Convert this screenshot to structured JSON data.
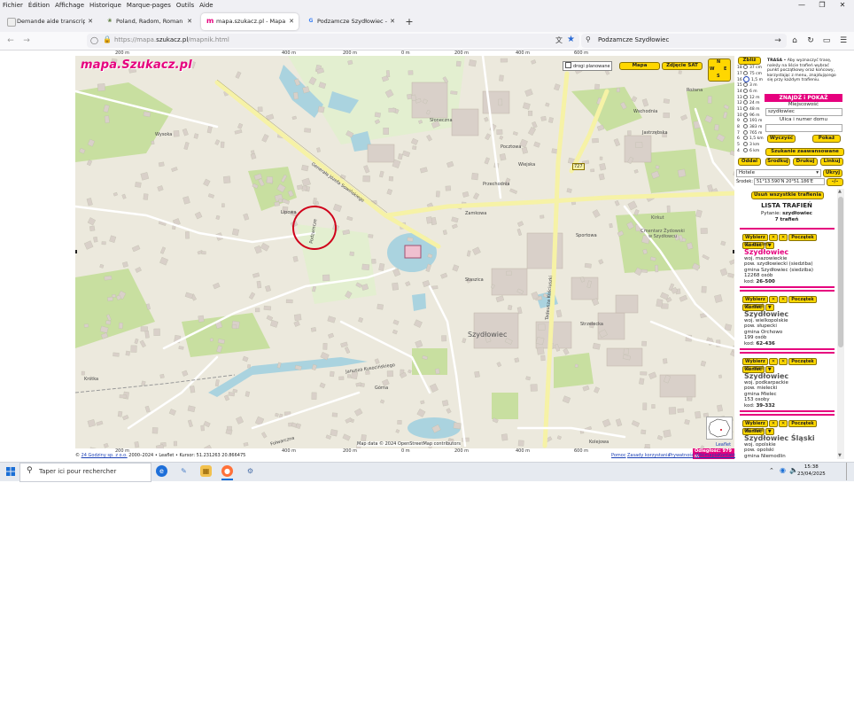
{
  "menubar": {
    "items": [
      "Fichier",
      "Édition",
      "Affichage",
      "Historique",
      "Marque-pages",
      "Outils",
      "Aide"
    ],
    "window_controls": [
      "minimize",
      "restore",
      "close"
    ]
  },
  "tabs": [
    {
      "label": "Demande aide transcription act",
      "icon": "document-icon",
      "active": false
    },
    {
      "label": "Poland, Radom, Roman Catholi",
      "icon": "family-tree-icon",
      "active": false
    },
    {
      "label": "mapa.szukacz.pl - Mapa Polski :",
      "icon": "szukacz-m-icon",
      "active": true
    },
    {
      "label": "Podzamcze Szydłowiec - Reche",
      "icon": "google-g-icon",
      "active": false
    }
  ],
  "navbar": {
    "url_prefix": "https://mapa.",
    "url_domain": "szukacz.pl",
    "url_suffix": "/mapnik.html",
    "search_value": "Podzamcze Szydłowiec"
  },
  "map": {
    "logo": "mapa.Szukacz.pl",
    "legend_checkbox": "drogi planowane",
    "mode_buttons": [
      "Mapa",
      "Zdjęcie SAT"
    ],
    "compass": [
      "N",
      "W",
      "E",
      "S"
    ],
    "scale_top": [
      "200 m",
      "400 m",
      "200 m",
      "0 m",
      "200 m",
      "400 m",
      "600 m"
    ],
    "scale_bottom": [
      "200 m",
      "400 m",
      "200 m",
      "0 m",
      "200 m",
      "400 m",
      "600 m"
    ],
    "labels": {
      "town": "Szydłowiec",
      "cemetery": "Cmentarz Żydowski w Szydłowcu",
      "kirkut": "Kirkut",
      "street1": "Generała Józefa Sowińskiego",
      "street2": "Zamkowa",
      "street3": "Tadeusza Kościuszki",
      "street4": "Janusza Kusocińskiego",
      "street5": "Folwarczna",
      "street6": "Górna",
      "street7": "Krótka",
      "street8": "Wysoka",
      "street9": "Podzamcze",
      "street10": "Rożana",
      "street11": "Słoneczna",
      "street12": "Wschodnia",
      "street13": "Jastrzębska",
      "street14": "Strzelecka",
      "street15": "Sportowa",
      "street16": "Wiejska",
      "street17": "Kolejowa",
      "street18": "Przechodnia",
      "street19": "Staszica",
      "street20": "Pocztowa",
      "street21": "Lipowa",
      "road_number": "727",
      "attribution": "Map data © 2024 OpenStreetMap contributors",
      "leaflet": "Leaflet"
    }
  },
  "footer": {
    "copyright_pre": "©",
    "copyright_link": "24 Godziny sp. z o.o.",
    "copyright_post": "2000–2024 • Leaflet • Kursor: 51.231263 20.866475",
    "links": [
      "Pomoc",
      "Zasady korzystania",
      "Prywatność",
      "Wikimapia",
      "Kontakt"
    ],
    "distance": "Odległość: 979 m"
  },
  "sidebar": {
    "zoom_label": "Zbliż",
    "oddal_label": "Oddal",
    "zoom_levels": [
      {
        "lvl": "18",
        "d": "37 cm"
      },
      {
        "lvl": "17",
        "d": "75 cm"
      },
      {
        "lvl": "16",
        "d": "1,5 m"
      },
      {
        "lvl": "15",
        "d": "3 m"
      },
      {
        "lvl": "14",
        "d": "6 m"
      },
      {
        "lvl": "13",
        "d": "12 m"
      },
      {
        "lvl": "12",
        "d": "24 m"
      },
      {
        "lvl": "11",
        "d": "48 m"
      },
      {
        "lvl": "10",
        "d": "96 m"
      },
      {
        "lvl": "9",
        "d": "191 m"
      },
      {
        "lvl": "8",
        "d": "383 m"
      },
      {
        "lvl": "7",
        "d": "765 m"
      },
      {
        "lvl": "6",
        "d": "1,5 km"
      },
      {
        "lvl": "5",
        "d": "3 km"
      },
      {
        "lvl": "4",
        "d": "6 km"
      }
    ],
    "selected_zoom": "16",
    "trasa_bold": "TRASA",
    "trasa_text": "• Aby wyznaczyć trasę, należy na liście trafień wybrać punkt początkowy oraz końcowy, korzystając z menu, znajdującego się przy każdym trafieniu.",
    "find_header": "ZNAJDŹ i POKAŻ",
    "city_label": "Miejscowość",
    "city_value": "szydłowiec",
    "street_label": "Ulica i numer domu",
    "street_value": "",
    "clear_button": "Wyczyść",
    "show_button": "Pokaż",
    "advanced_button": "Szukanie zaawansowane",
    "actions": [
      "Oddal",
      "Środkuj",
      "Drukuj",
      "Linkuj"
    ],
    "select_value": "Hotele",
    "hide_button": "Ukryj",
    "center_label": "Środek:",
    "center_value": "51°13.590'N 20°51.186'E",
    "center_btn": "–/–",
    "remove_all": "Usuń wszystkie trafienia",
    "list_title": "LISTA TRAFIEŃ",
    "query_label": "Pytanie:",
    "query_value": "szydłowiec",
    "hits": "7 trafień",
    "result_buttons": [
      "Wybierz",
      "✕",
      "✕",
      "Początek",
      "Koniec",
      "▼"
    ],
    "results": [
      {
        "type": "(1) miasto",
        "name": "Szydłowiec",
        "lines": [
          "woj. mazowieckie",
          "pow. szydłowiecki (siedziba)",
          "gmina Szydłowiec (siedziba)",
          "12268 osób"
        ],
        "code": "26-500",
        "highlight": true
      },
      {
        "type": "(2) wieś",
        "name": "Szydłowiec",
        "lines": [
          "woj. wielkopolskie",
          "pow. słupecki",
          "gmina Orchowo",
          "199 osób"
        ],
        "code": "62-436",
        "highlight": false
      },
      {
        "type": "(3) wieś",
        "name": "Szydłowiec",
        "lines": [
          "woj. podkarpackie",
          "pow. mielecki",
          "gmina Mielec",
          "153 osoby"
        ],
        "code": "39-332",
        "highlight": false
      },
      {
        "type": "(4) wieś",
        "name": "Szydłowiec Śląski",
        "lines": [
          "woj. opolskie",
          "pow. opolski",
          "gmina Niemodlin"
        ],
        "code": "",
        "highlight": false
      }
    ],
    "code_label": "kod:"
  },
  "taskbar": {
    "search_placeholder": "Taper ici pour rechercher",
    "time": "15:38",
    "date": "23/04/2025"
  },
  "colors": {
    "accent": "#e6007e",
    "yellow": "#ffd700",
    "map_bg": "#ece9dd",
    "road": "#f6f2a6",
    "water": "#aad3df",
    "green": "#c8dfa0"
  }
}
